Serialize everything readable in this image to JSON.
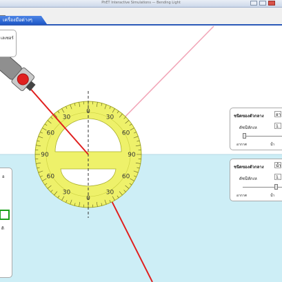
{
  "window": {
    "title": "PhET Interactive Simulations — Bending Light"
  },
  "toolbar": {
    "tab_label": "เครื่องมือต่างๆ"
  },
  "laser_panel": {
    "label": "เลเซอร์"
  },
  "medium_top": {
    "title": "ชนิดของตัวกลาง",
    "medium_value": "อา",
    "index_label": "ดัชนีหักเห",
    "index_value": "1.",
    "slider_min_label": "อากาศ",
    "slider_max_label": "น้ำ"
  },
  "medium_bottom": {
    "title": "ชนิดของตัวกลาง",
    "medium_value": "น้ำ",
    "index_label": "ดัชนีหักเห",
    "index_value": "1.",
    "slider_min_label": "อากาศ",
    "slider_max_label": "น้ำ"
  },
  "left_panel": {
    "top_text": "อ",
    "bottom_text": "ดิ"
  },
  "protractor": {
    "labels": [
      "0",
      "30",
      "60",
      "90",
      "60",
      "30",
      "0",
      "30",
      "60",
      "90",
      "60",
      "30"
    ]
  },
  "colors": {
    "air": "#ffffff",
    "water": "#cdeef6",
    "laser_beam": "#e0201f",
    "reflected_beam": "#f2a6b8",
    "protractor": "#eef16a"
  }
}
